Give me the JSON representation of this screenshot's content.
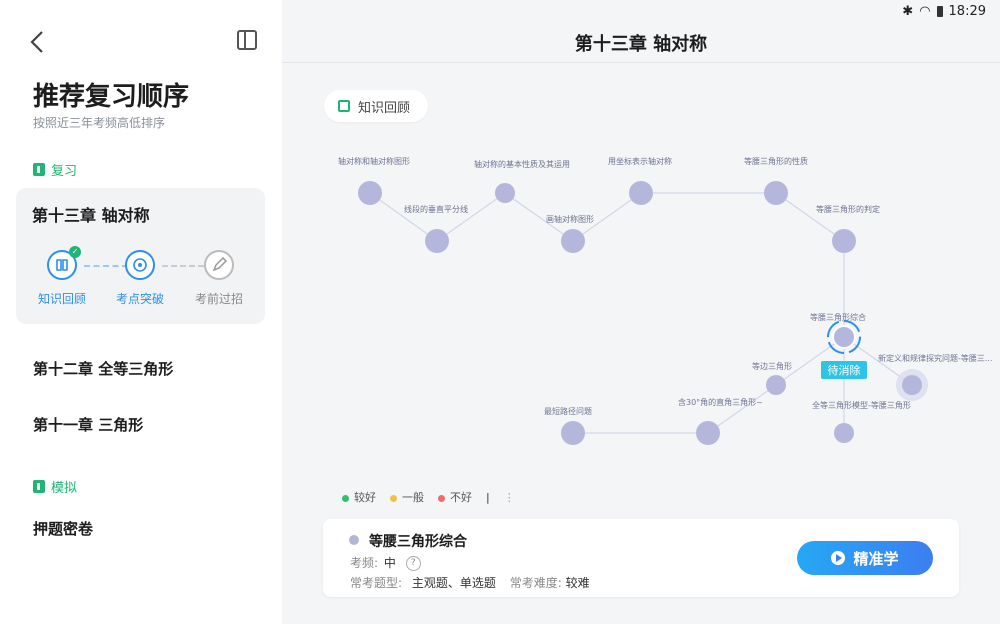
{
  "status": {
    "time": "18:29"
  },
  "sidebar": {
    "title": "推荐复习顺序",
    "subtitle": "按照近三年考频高低排序",
    "section_review": "复习",
    "section_mock": "模拟",
    "current": {
      "title": "第十三章 轴对称",
      "steps": [
        "知识回顾",
        "考点突破",
        "考前过招"
      ]
    },
    "chapters": [
      "第十二章 全等三角形",
      "第十一章 三角形"
    ],
    "mock_item": "押题密卷"
  },
  "main": {
    "title": "第十三章 轴对称",
    "review_chip": "知识回顾",
    "nodes": [
      "轴对称和轴对称图形",
      "线段的垂直平分线",
      "轴对称的基本性质及其运用",
      "画轴对称图形",
      "用坐标表示轴对称",
      "等腰三角形的性质",
      "等腰三角形的判定",
      "等腰三角形综合",
      "新定义和规律探究问题-等腰三...",
      "等边三角形",
      "全等三角形模型-等腰三角形",
      "含30°角的直角三角形~",
      "最短路径问题"
    ],
    "pending_badge": "待消除",
    "legend": [
      "较好",
      "一般",
      "不好"
    ],
    "legend_colors": [
      "#31c06f",
      "#f5c03c",
      "#f06b6b"
    ],
    "node_color": "#b4b7db",
    "detail": {
      "title": "等腰三角形综合",
      "freq_label": "考频:",
      "freq_value": "中",
      "types_label": "常考题型:",
      "types_value": "主观题、单选题",
      "difficulty_label": "常考难度:",
      "difficulty_value": "较难",
      "button": "精准学"
    }
  }
}
